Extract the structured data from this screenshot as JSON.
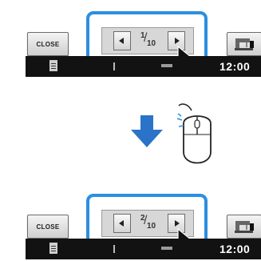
{
  "top_panel": {
    "close_label": "CLOSE",
    "page_current": "1",
    "page_total": "10",
    "clock": "12:00"
  },
  "bottom_panel": {
    "close_label": "CLOSE",
    "page_current": "2",
    "page_total": "10",
    "clock": "12:00"
  },
  "icons": {
    "prev": "triangle-left-icon",
    "next": "triangle-right-icon",
    "cursor": "pointer-cursor-icon",
    "sewing": "sewing-machine-icon",
    "doc": "document-icon",
    "down_arrow": "down-arrow-icon",
    "mouse": "mouse-icon"
  },
  "colors": {
    "highlight": "#2c8fe0",
    "status_bar": "#121212",
    "arrow": "#2a73c9"
  }
}
